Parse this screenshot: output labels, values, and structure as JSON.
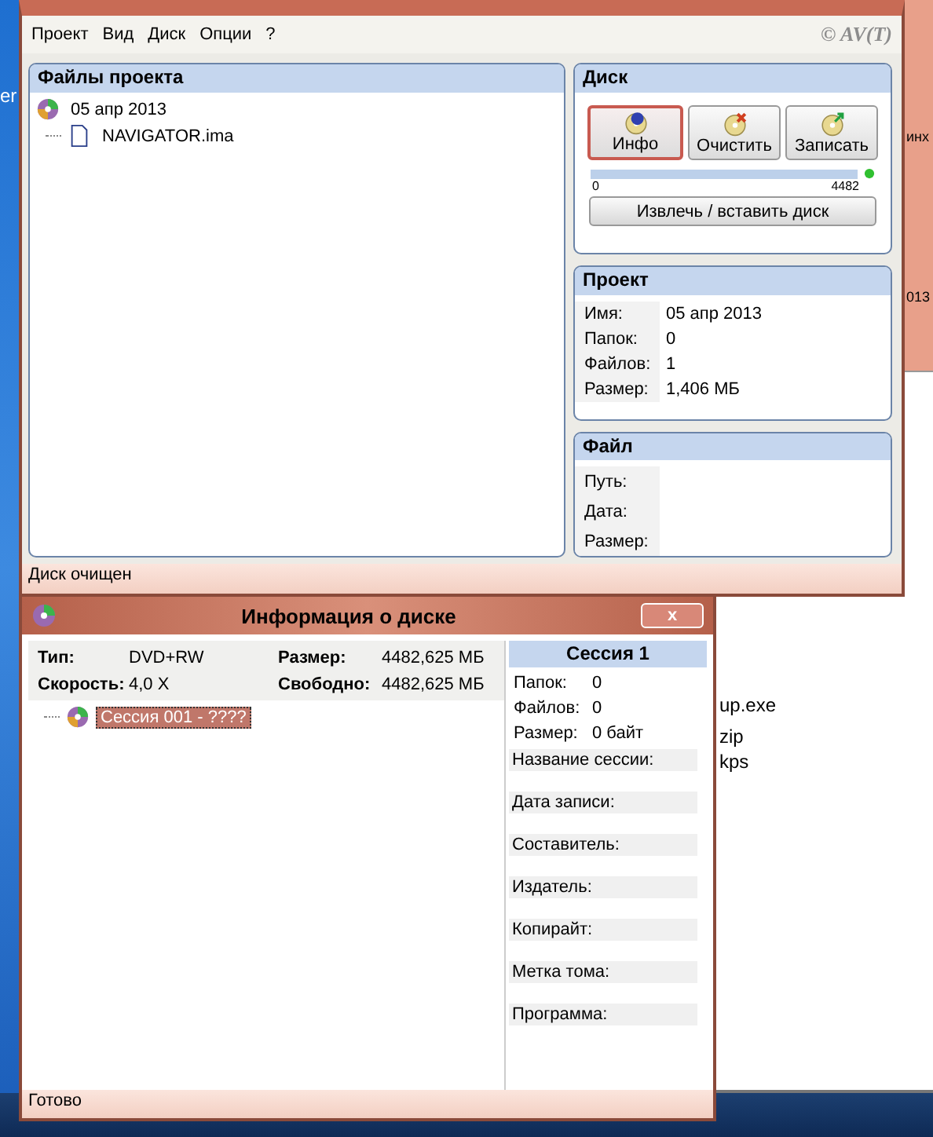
{
  "desktop": {
    "fragments": [
      "er",
      "инх",
      "013",
      "up.exe",
      "zip",
      "kps"
    ]
  },
  "main_window": {
    "menu": [
      "Проект",
      "Вид",
      "Диск",
      "Опции",
      "?"
    ],
    "copyright": "© AV(T)",
    "files_panel": {
      "title": "Файлы проекта",
      "tree": [
        {
          "label": "05 апр 2013",
          "kind": "disc",
          "children": [
            {
              "label": "NAVIGATOR.ima",
              "kind": "file"
            }
          ]
        }
      ]
    },
    "disc_panel": {
      "title": "Диск",
      "buttons": [
        {
          "label": "Инфо",
          "kind": "info",
          "selected": true
        },
        {
          "label": "Очистить",
          "kind": "erase",
          "selected": false
        },
        {
          "label": "Записать",
          "kind": "write",
          "selected": false
        }
      ],
      "capacity": {
        "min": "0",
        "max": "4482"
      },
      "eject_button": "Извлечь / вставить диск"
    },
    "project_panel": {
      "title": "Проект",
      "fields": [
        {
          "label": "Имя:",
          "value": "05 апр 2013"
        },
        {
          "label": "Папок:",
          "value": "0"
        },
        {
          "label": "Файлов:",
          "value": "1"
        },
        {
          "label": "Размер:",
          "value": "1,406 МБ"
        }
      ]
    },
    "file_panel": {
      "title": "Файл",
      "fields": [
        {
          "label": "Путь:"
        },
        {
          "label": "Дата:"
        },
        {
          "label": "Размер:"
        }
      ]
    },
    "status_bar": "Диск очищен"
  },
  "dialog": {
    "title": "Информация о диске",
    "close": "x",
    "info": [
      {
        "label": "Тип:",
        "value": "DVD+RW"
      },
      {
        "label": "Размер:",
        "value": "4482,625 МБ"
      },
      {
        "label": "Скорость:",
        "value": "4,0 X"
      },
      {
        "label": "Свободно:",
        "value": "4482,625 МБ"
      }
    ],
    "tree": [
      {
        "label": "Сессия 001 - ????",
        "selected": true
      }
    ],
    "session": {
      "title": "Сессия 1",
      "stats": [
        {
          "label": "Папок:",
          "value": "0"
        },
        {
          "label": "Файлов:",
          "value": "0"
        },
        {
          "label": "Размер:",
          "value": "0 байт"
        }
      ],
      "fields": [
        "Название сессии:",
        "Дата записи:",
        "Составитель:",
        "Издатель:",
        "Копирайт:",
        "Метка тома:",
        "Программа:"
      ]
    },
    "status_bar": "Готово"
  }
}
